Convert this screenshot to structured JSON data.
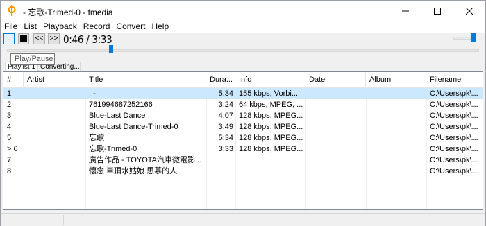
{
  "window": {
    "title": " - 忘歌-Trimed-0 - fmedia",
    "app_icon": "fmedia-logo-icon",
    "accent": "#ff9900"
  },
  "menu": [
    "File",
    "List",
    "Playback",
    "Record",
    "Convert",
    "Help"
  ],
  "toolbar": {
    "play_label": ".",
    "prev_label": "<<",
    "next_label": ">>",
    "time": "0:46 / 3:33",
    "seek_position": 0.22,
    "volume_level": 0.9
  },
  "tooltip": "Play/Pause",
  "tabs": [
    "Playlist 1",
    "Converting..."
  ],
  "table": {
    "columns": [
      "#",
      "Artist",
      "Title",
      "Dura...",
      "Info",
      "Date",
      "Album",
      "Filename"
    ],
    "rows": [
      {
        "num": "1",
        "artist": "",
        "title": ". -",
        "duration": "5:34",
        "info": "155 kbps, Vorbi...",
        "date": "",
        "album": "",
        "filename": "C:\\Users\\pk\\...",
        "selected": true
      },
      {
        "num": "2",
        "artist": "",
        "title": "761994687252166",
        "duration": "3:24",
        "info": "64 kbps, MPEG, ...",
        "date": "",
        "album": "",
        "filename": "C:\\Users\\pk\\...",
        "selected": false
      },
      {
        "num": "3",
        "artist": "",
        "title": "Blue-Last Dance",
        "duration": "4:07",
        "info": "128 kbps, MPEG...",
        "date": "",
        "album": "",
        "filename": "C:\\Users\\pk\\...",
        "selected": false
      },
      {
        "num": "4",
        "artist": "",
        "title": "Blue-Last Dance-Trimed-0",
        "duration": "3:49",
        "info": "128 kbps, MPEG...",
        "date": "",
        "album": "",
        "filename": "C:\\Users\\pk\\...",
        "selected": false
      },
      {
        "num": "5",
        "artist": "",
        "title": "忘歌",
        "duration": "5:34",
        "info": "128 kbps, MPEG...",
        "date": "",
        "album": "",
        "filename": "C:\\Users\\pk\\...",
        "selected": false
      },
      {
        "num": "> 6",
        "artist": "",
        "title": "忘歌-Trimed-0",
        "duration": "3:33",
        "info": "128 kbps, MPEG...",
        "date": "",
        "album": "",
        "filename": "C:\\Users\\pk\\...",
        "selected": false
      },
      {
        "num": "7",
        "artist": "",
        "title": "廣告作品 - TOYOTA汽車微電影...",
        "duration": "",
        "info": "",
        "date": "",
        "album": "",
        "filename": "C:\\Users\\pk\\...",
        "selected": false
      },
      {
        "num": "8",
        "artist": "",
        "title": "懷念 車頂水姑娘 思慕的人",
        "duration": "",
        "info": "",
        "date": "",
        "album": "",
        "filename": "C:\\Users\\pk\\...",
        "selected": false
      }
    ]
  },
  "colors": {
    "selection": "#cce8ff",
    "slider_thumb": "#007ad9"
  }
}
